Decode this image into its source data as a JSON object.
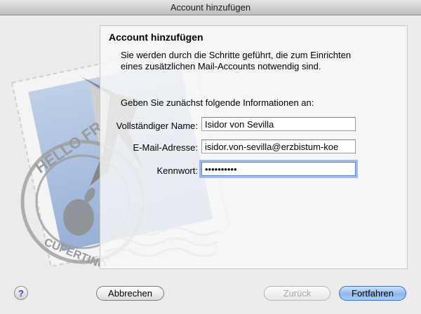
{
  "window": {
    "title": "Account hinzufügen"
  },
  "panel": {
    "heading": "Account hinzufügen",
    "intro": "Sie werden durch die Schritte geführt, die zum Einrichten eines zusätzlichen Mail-Accounts notwendig sind.",
    "prompt": "Geben Sie zunächst folgende Informationen an:"
  },
  "form": {
    "full_name_label": "Vollständiger Name:",
    "full_name_value": "Isidor von Sevilla",
    "email_label": "E-Mail-Adresse:",
    "email_value": "isidor.von-sevilla@erzbistum-koe",
    "password_label": "Kennwort:",
    "password_value": "••••••••••"
  },
  "stamp": {
    "text_top": "HELLO FR",
    "text_bottom": "CUPERTINO, CA"
  },
  "buttons": {
    "help": "?",
    "cancel": "Abbrechen",
    "back": "Zurück",
    "continue": "Fortfahren"
  },
  "colors": {
    "accent": "#5a8ad6",
    "default_button": "#8bb8ef"
  }
}
